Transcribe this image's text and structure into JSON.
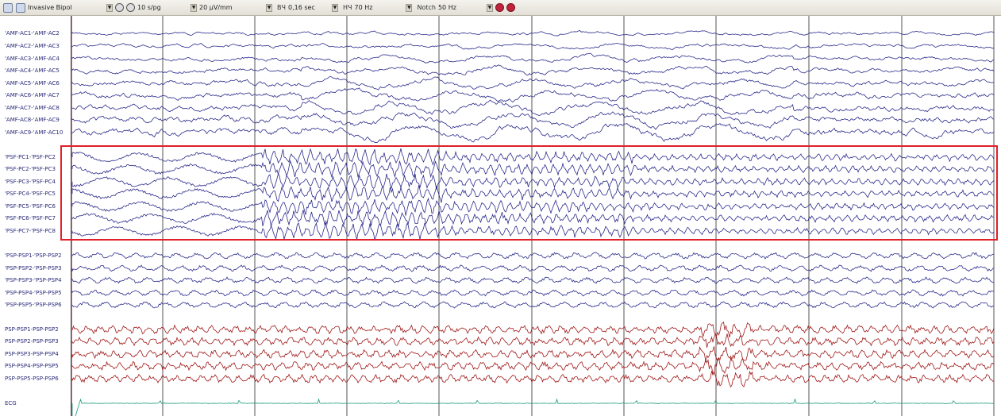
{
  "toolbar": {
    "montage": "Invasive Bipol",
    "speed": "10 s/pg",
    "sensitivity": "20 µV/mm",
    "hf_label": "ВЧ",
    "hf_value": "0,16 sec",
    "lf_label": "НЧ",
    "lf_value": "70 Hz",
    "notch_label": "Notch",
    "notch_value": "50 Hz"
  },
  "colors": {
    "blue": "#2b2b8c",
    "red": "#a01818",
    "green": "#1a9a7a",
    "grid": "#555555",
    "marker": "#d04060",
    "selection": "#e0202a"
  },
  "channels": [
    {
      "label": "'AMF-AC1-'AMF-AC2",
      "group": "amf"
    },
    {
      "label": "'AMF-AC2-'AMF-AC3",
      "group": "amf"
    },
    {
      "label": "'AMF-AC3-'AMF-AC4",
      "group": "amf"
    },
    {
      "label": "'AMF-AC4-'AMF-AC5",
      "group": "amf"
    },
    {
      "label": "'AMF-AC5-'AMF-AC6",
      "group": "amf"
    },
    {
      "label": "'AMF-AC6-'AMF-AC7",
      "group": "amf"
    },
    {
      "label": "'AMF-AC7-'AMF-AC8",
      "group": "amf"
    },
    {
      "label": "'AMF-AC8-'AMF-AC9",
      "group": "amf"
    },
    {
      "label": "'AMF-AC9-'AMF-AC10",
      "group": "amf"
    },
    {
      "label": "'PSF-PC1-'PSF-PC2",
      "group": "psf"
    },
    {
      "label": "'PSF-PC2-'PSF-PC3",
      "group": "psf"
    },
    {
      "label": "'PSF-PC3-'PSF-PC4",
      "group": "psf"
    },
    {
      "label": "'PSF-PC4-'PSF-PC5",
      "group": "psf"
    },
    {
      "label": "'PSF-PC5-'PSF-PC6",
      "group": "psf"
    },
    {
      "label": "'PSF-PC6-'PSF-PC7",
      "group": "psf"
    },
    {
      "label": "'PSF-PC7-'PSF-PC8",
      "group": "psf"
    },
    {
      "label": "'PSP-PSP1-'PSP-PSP2",
      "group": "psp"
    },
    {
      "label": "'PSP-PSP2-'PSP-PSP3",
      "group": "psp"
    },
    {
      "label": "'PSP-PSP3-'PSP-PSP4",
      "group": "psp"
    },
    {
      "label": "'PSP-PSP4-'PSP-PSP5",
      "group": "psp"
    },
    {
      "label": "'PSP-PSP5-'PSP-PSP6",
      "group": "psp"
    },
    {
      "label": "PSP-PSP1-PSP-PSP2",
      "group": "pspr"
    },
    {
      "label": "PSP-PSP2-PSP-PSP3",
      "group": "pspr"
    },
    {
      "label": "PSP-PSP3-PSP-PSP4",
      "group": "pspr"
    },
    {
      "label": "PSP-PSP4-PSP-PSP5",
      "group": "pspr"
    },
    {
      "label": "PSP-PSP5-PSP-PSP6",
      "group": "pspr"
    },
    {
      "label": "ECG",
      "group": "ecg"
    }
  ]
}
